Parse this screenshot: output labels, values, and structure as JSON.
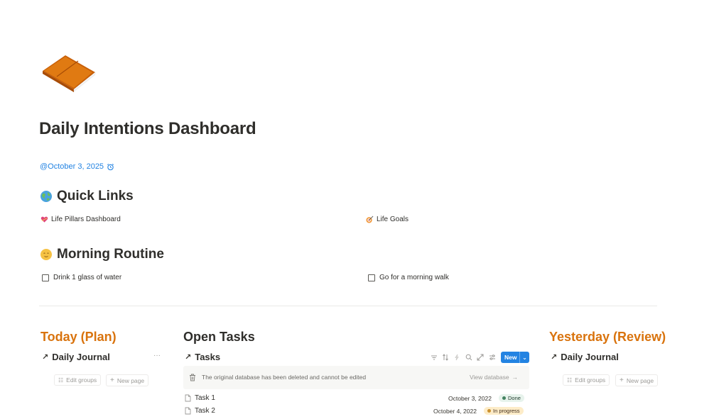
{
  "page": {
    "title": "Daily Intentions Dashboard",
    "date": "@October 3, 2025",
    "book_icon": "journal-book-icon"
  },
  "quick_links": {
    "heading": "Quick Links",
    "icon": "globe-icon",
    "items": [
      {
        "label": "Life Pillars Dashboard",
        "icon": "heart-icon"
      },
      {
        "label": "Life Goals",
        "icon": "dart-target-icon"
      }
    ]
  },
  "morning_routine": {
    "heading": "Morning Routine",
    "icon": "sun-face-icon",
    "todos": [
      {
        "label": "Drink 1 glass of water",
        "checked": false
      },
      {
        "label": "Go for a morning walk",
        "checked": false
      }
    ]
  },
  "today": {
    "heading": "Today (Plan)",
    "view_title": "Daily Journal",
    "more": "···",
    "edit_groups": "Edit groups",
    "new_page": "New page"
  },
  "open_tasks": {
    "heading": "Open Tasks",
    "view_title": "Tasks",
    "new_label": "New",
    "banner_text": "The original database has been deleted and cannot be edited",
    "view_database": "View database",
    "rows": [
      {
        "name": "Task 1",
        "date": "October 3, 2022",
        "status": "Done",
        "status_color": "#448361",
        "status_bg": "#e7f3ec"
      },
      {
        "name": "Task 2",
        "date": "October 4, 2022",
        "status": "In progress",
        "status_color": "#cb912f",
        "status_bg": "#fdecc8"
      }
    ]
  },
  "yesterday": {
    "heading": "Yesterday (Review)",
    "view_title": "Daily Journal",
    "edit_groups": "Edit groups",
    "new_page": "New page"
  },
  "colors": {
    "accent": "#2383e2",
    "orange_heading": "#d9730d"
  }
}
